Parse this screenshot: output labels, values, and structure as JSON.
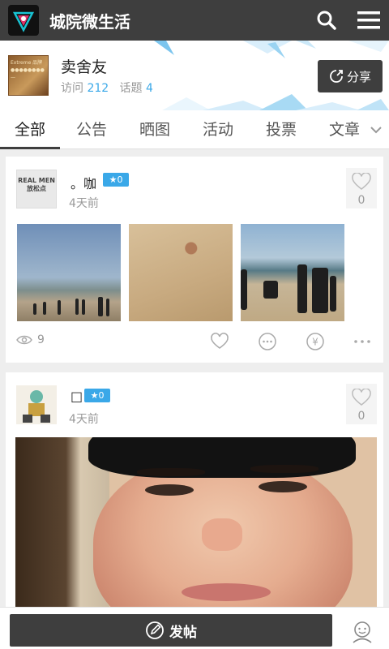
{
  "app": {
    "title": "城院微生活"
  },
  "board": {
    "name": "卖舍友",
    "visit_label": "访问",
    "visit_count": "212",
    "topic_label": "话题",
    "topic_count": "4",
    "share_label": "分享",
    "thumb_text": "Extreme 品牌 ●●●●●●●● —"
  },
  "tabs": [
    {
      "label": "全部"
    },
    {
      "label": "公告"
    },
    {
      "label": "晒图"
    },
    {
      "label": "活动"
    },
    {
      "label": "投票"
    },
    {
      "label": "文章"
    }
  ],
  "posts": [
    {
      "username": "。咖",
      "level": "0",
      "time": "4天前",
      "likes": "0",
      "views": "9",
      "avatar_text": "REAL MEN 放松点"
    },
    {
      "username": "□",
      "level": "0",
      "time": "4天前",
      "likes": "0"
    }
  ],
  "bottom": {
    "post_label": "发帖"
  },
  "colors": {
    "bar": "#3e3e3e",
    "accent": "#3aa8e8"
  }
}
